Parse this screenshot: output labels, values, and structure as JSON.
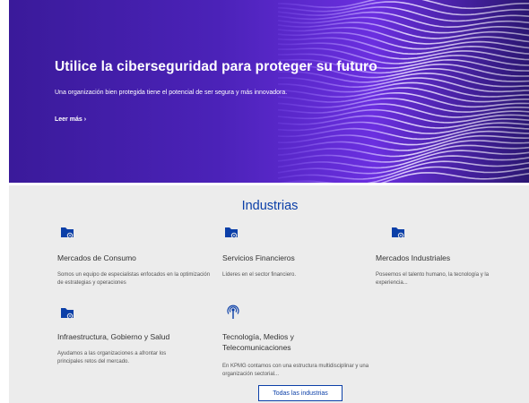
{
  "hero": {
    "title": "Utilice la ciberseguridad para proteger su futuro",
    "text": "Una organización bien protegida tiene el potencial de ser segura y más innovadora.",
    "link": "Leer más"
  },
  "industries": {
    "title": "Industrias",
    "items": [
      {
        "title": "Mercados de Consumo",
        "desc": "Somos un equipo de especialistas enfocados en la optimización de estrategias y operaciones",
        "icon": "folder-gear-icon"
      },
      {
        "title": "Servicios Financieros",
        "desc": "Líderes en el sector financiero.",
        "icon": "folder-gear-icon"
      },
      {
        "title": "Mercados Industriales",
        "desc": "Poseemos el talento humano, la tecnología y la experiencia...",
        "icon": "folder-gear-icon"
      },
      {
        "title": "Infraestructura, Gobierno y Salud",
        "desc": "Ayudamos a las organizaciones a afrontar los principales retos del mercado.",
        "icon": "folder-gear-icon"
      },
      {
        "title": "Tecnología, Medios y Telecomunicaciones",
        "desc": "En KPMG contamos con una estructura multidisciplinar y una organización sectorial...",
        "icon": "broadcast-icon"
      }
    ],
    "button": "Todas las industrias"
  },
  "colors": {
    "accent": "#0b3fa8",
    "hero": "#4b22b8",
    "section_bg": "#ececec"
  }
}
